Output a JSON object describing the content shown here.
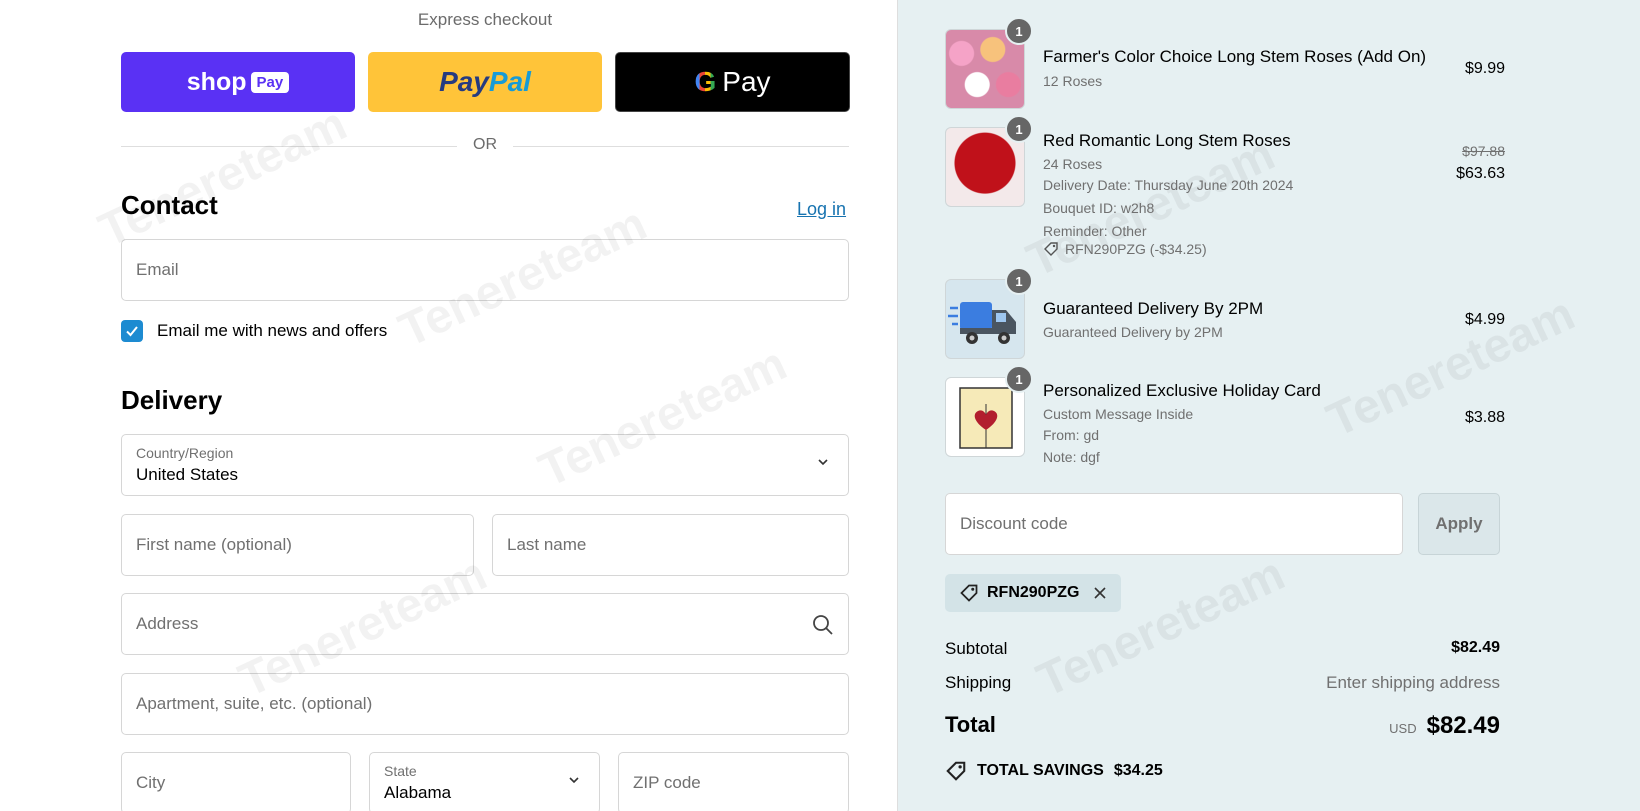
{
  "express": {
    "title": "Express checkout",
    "shop_label": "shop",
    "shop_pill": "Pay",
    "paypal_a": "Pay",
    "paypal_b": "Pal",
    "gpay_g": "G",
    "gpay_label": "Pay"
  },
  "divider": "OR",
  "contact": {
    "heading": "Contact",
    "login": "Log in",
    "email_placeholder": "Email",
    "newsletter_label": "Email me with news and offers",
    "newsletter_checked": true
  },
  "delivery": {
    "heading": "Delivery",
    "country_label": "Country/Region",
    "country_value": "United States",
    "first_name_placeholder": "First name (optional)",
    "last_name_placeholder": "Last name",
    "address_placeholder": "Address",
    "apartment_placeholder": "Apartment, suite, etc. (optional)",
    "city_placeholder": "City",
    "state_label": "State",
    "state_value": "Alabama",
    "zip_placeholder": "ZIP code"
  },
  "cart": {
    "items": [
      {
        "qty": "1",
        "name": "Farmer's Color Choice Long Stem Roses (Add On)",
        "lines": [
          "12 Roses"
        ],
        "price": "$9.99"
      },
      {
        "qty": "1",
        "name": "Red Romantic Long Stem Roses",
        "lines": [
          "24 Roses",
          "Delivery Date: Thursday June 20th 2024",
          "Bouquet ID: w2h8",
          "Reminder: Other"
        ],
        "discount": "RFN290PZG (-$34.25)",
        "original_price": "$97.88",
        "price": "$63.63"
      },
      {
        "qty": "1",
        "name": "Guaranteed Delivery By 2PM",
        "lines": [
          "Guaranteed Delivery by 2PM"
        ],
        "price": "$4.99"
      },
      {
        "qty": "1",
        "name": "Personalized Exclusive Holiday Card",
        "lines": [
          "Custom Message Inside",
          "From: gd",
          "Note: dgf"
        ],
        "price": "$3.88"
      }
    ],
    "discount_placeholder": "Discount code",
    "apply_label": "Apply",
    "applied_code": "RFN290PZG",
    "subtotal_label": "Subtotal",
    "subtotal_value": "$82.49",
    "shipping_label": "Shipping",
    "shipping_value": "Enter shipping address",
    "total_label": "Total",
    "currency": "USD",
    "total_value": "$82.49",
    "savings_label": "TOTAL SAVINGS",
    "savings_value": "$34.25"
  },
  "watermark": "Tenereteam"
}
